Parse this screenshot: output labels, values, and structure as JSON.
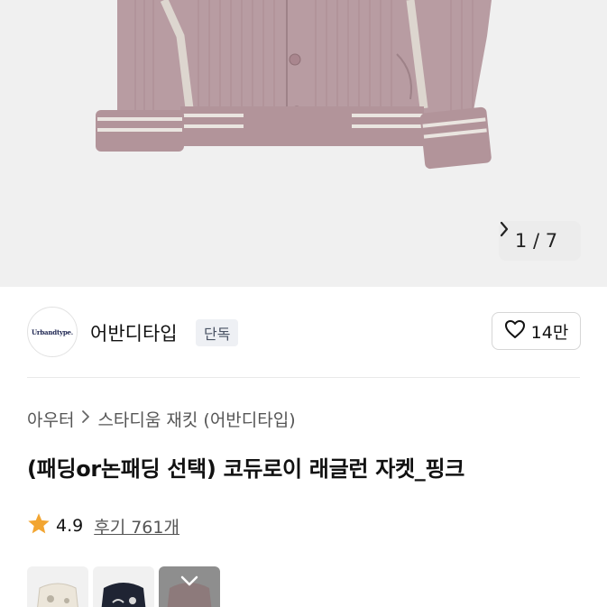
{
  "gallery": {
    "counter_text": "1 / 7",
    "next_icon": "chevron-right-icon",
    "jacket_color": "#b59aa0",
    "stripe_color": "#e6e1dc"
  },
  "store": {
    "logo_text": "Urbandtype.",
    "name": "어반디타입",
    "badge": "단독",
    "likes": "14만",
    "like_icon": "heart-outline-icon"
  },
  "breadcrumb": {
    "category": "아우터",
    "subcategory": "스타디움 재킷 (어반디타입)"
  },
  "product": {
    "title": "(패딩or논패딩 선택) 코듀로이 래글런 자켓_핑크",
    "rating": "4.9",
    "reviews": "후기 761개",
    "star_color": "#f2a531"
  },
  "options": [
    {
      "name": "ivory"
    },
    {
      "name": "navy"
    },
    {
      "name": "pink",
      "selected": true
    }
  ]
}
